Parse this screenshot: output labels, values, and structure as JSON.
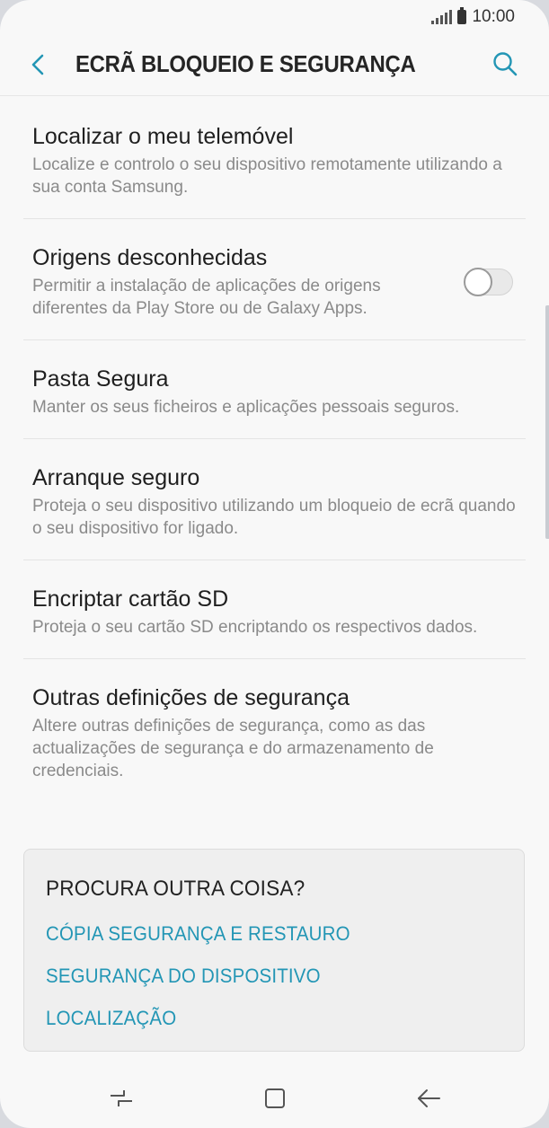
{
  "status_bar": {
    "time": "10:00"
  },
  "header": {
    "title": "ECRÃ BLOQUEIO E SEGURANÇA"
  },
  "items": [
    {
      "title": "Localizar o meu telemóvel",
      "subtitle": "Localize e controlo o seu dispositivo remotamente utilizando a sua conta Samsung."
    },
    {
      "title": "Origens desconhecidas",
      "subtitle": "Permitir a instalação de aplicações de origens diferentes da Play Store ou de Galaxy Apps.",
      "toggle_on": false
    },
    {
      "title": "Pasta Segura",
      "subtitle": "Manter os seus ficheiros e aplicações pessoais seguros."
    },
    {
      "title": "Arranque seguro",
      "subtitle": "Proteja o seu dispositivo utilizando um bloqueio de ecrã quando o seu dispositivo for ligado."
    },
    {
      "title": "Encriptar cartão SD",
      "subtitle": "Proteja o seu cartão SD encriptando os respectivos dados."
    },
    {
      "title": "Outras definições de segurança",
      "subtitle": "Altere outras definições de segurança, como as das actualizações de segurança e do armazenamento de credenciais."
    }
  ],
  "suggestions": {
    "title": "PROCURA OUTRA COISA?",
    "links": [
      "CÓPIA SEGURANÇA E RESTAURO",
      "SEGURANÇA DO DISPOSITIVO",
      "LOCALIZAÇÃO"
    ]
  },
  "colors": {
    "accent": "#2396b5",
    "background": "#f8f8f8",
    "card": "#efefef"
  },
  "icons": {
    "back": "back-arrow-icon",
    "search": "search-icon",
    "nav_recents": "recent-apps-icon",
    "nav_home": "home-icon",
    "nav_back": "back-icon"
  }
}
